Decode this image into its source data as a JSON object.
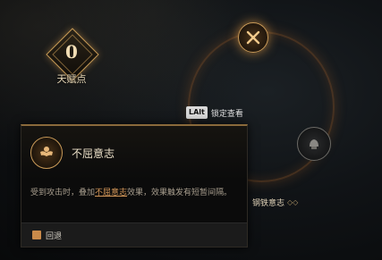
{
  "talent": {
    "value": "0",
    "label": "天赋点"
  },
  "hint": {
    "key": "LAlt",
    "action": "锁定查看"
  },
  "node_right_label": "钢铁意志",
  "tooltip": {
    "title": "不屈意志",
    "desc_prefix": "受到攻击时，叠加",
    "desc_keyword": "不屈意志",
    "desc_suffix": "效果，效果触发有短暂间隔。",
    "back_label": "回退"
  },
  "icons": {
    "talent_node_top": "crossed-blades-icon",
    "talent_node_right": "iron-will-icon",
    "tooltip_icon": "muscle-icon",
    "back": "back-book-icon"
  },
  "colors": {
    "accent_gold": "#c99a58",
    "keyword_orange": "#d89a5a"
  }
}
